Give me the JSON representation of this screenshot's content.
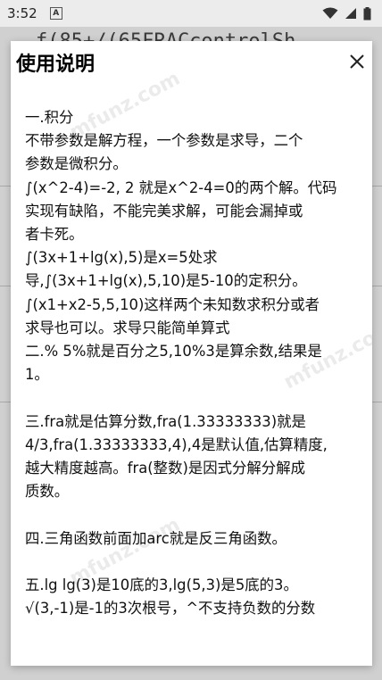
{
  "status_bar": {
    "time": "3:52",
    "notification_letter": "A"
  },
  "background": {
    "code_line": "f(85+/(65FRACcontrolSh"
  },
  "dialog": {
    "title": "使用说明",
    "lines": [
      "",
      "一.积分",
      "不带参数是解方程，一个参数是求导，二个",
      "参数是微积分。",
      "∫(x^2-4)=-2, 2 就是x^2-4=0的两个解。代码",
      "实现有缺陷，不能完美求解，可能会漏掉或",
      "者卡死。",
      "∫(3x+1+lg(x),5)是x=5处求",
      "导,∫(3x+1+lg(x),5,10)是5-10的定积分。",
      "∫(x1+x2-5,5,10)这样两个未知数求积分或者",
      "求导也可以。求导只能简单算式",
      "二.% 5%就是百分之5,10%3是算余数,结果是",
      "1。",
      "",
      "三.fra就是估算分数,fra(1.33333333)就是",
      "4/3,fra(1.33333333,4),4是默认值,估算精度,",
      "越大精度越高。fra(整数)是因式分解分解成",
      "质数。",
      "",
      "四.三角函数前面加arc就是反三角函数。",
      "",
      "五.lg lg(3)是10底的3,lg(5,3)是5底的3。",
      "√(3,-1)是-1的3次根号，^不支持负数的分数"
    ]
  },
  "watermark_text": "mfunz.com"
}
